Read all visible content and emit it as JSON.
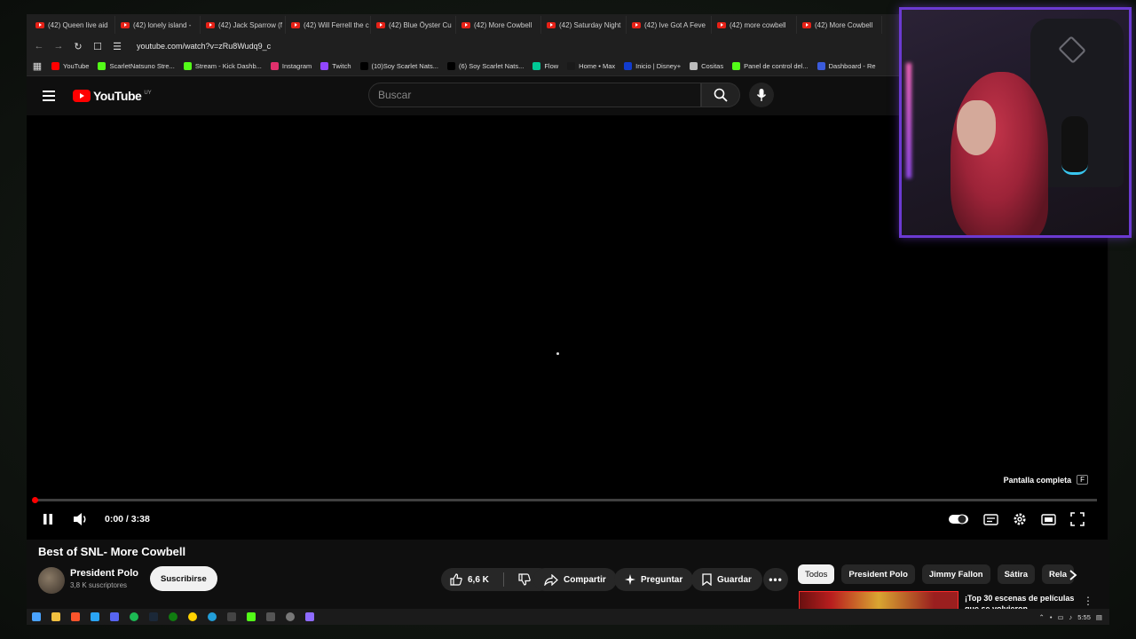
{
  "tabs": [
    "(42) Queen live aid",
    "(42) lonely island -",
    "(42) Jack Sparrow (f",
    "(42) Will Ferrell the c",
    "(42) Blue Öyster Cu",
    "(42) More Cowbell",
    "(42) Saturday Night",
    "(42) Ive Got A Feve",
    "(42) more cowbell",
    "(42) More Cowbell"
  ],
  "address": {
    "url": "youtube.com/watch?v=zRu8Wudq9_c"
  },
  "bookmarks": [
    {
      "label": "YouTube",
      "color": "#ff0000"
    },
    {
      "label": "ScarletNatsuno Stre...",
      "color": "#53fc18"
    },
    {
      "label": "Stream - Kick Dashb...",
      "color": "#53fc18"
    },
    {
      "label": "Instagram",
      "color": "#e1306c"
    },
    {
      "label": "Twitch",
      "color": "#9146ff"
    },
    {
      "label": "(10)Soy Scarlet Nats...",
      "color": "#000000"
    },
    {
      "label": "(6) Soy Scarlet Nats...",
      "color": "#000000"
    },
    {
      "label": "Flow",
      "color": "#00c896"
    },
    {
      "label": "Home • Max",
      "color": "#1a1a1a"
    },
    {
      "label": "Inicio | Disney+",
      "color": "#113ccf"
    },
    {
      "label": "Cositas",
      "color": "#bbbbbb"
    },
    {
      "label": "Panel de control del...",
      "color": "#53fc18"
    },
    {
      "label": "Dashboard - Re",
      "color": "#3b5bdb"
    }
  ],
  "youtube": {
    "logo_text": "YouTube",
    "country_code": "UY",
    "search_placeholder": "Buscar"
  },
  "player": {
    "fullscreen_tooltip": "Pantalla completa",
    "fullscreen_key": "F",
    "time": "0:00 / 3:38",
    "progress": 0.0
  },
  "video": {
    "title": "Best of SNL- More Cowbell",
    "channel": "President Polo",
    "subscribers": "3,8 K suscriptores",
    "subscribe_label": "Suscribirse",
    "likes": "6,6 K",
    "share_label": "Compartir",
    "ask_label": "Preguntar",
    "save_label": "Guardar"
  },
  "chips": [
    "Todos",
    "President Polo",
    "Jimmy Fallon",
    "Sátira",
    "Rela"
  ],
  "recommendation": {
    "title": "¡Top 30 escenas de películas que se volvieron ..."
  },
  "taskbar": {
    "clock": "5:55"
  },
  "colors": {
    "accent": "#ff0000",
    "webcam_border": "#6b3ad1"
  }
}
